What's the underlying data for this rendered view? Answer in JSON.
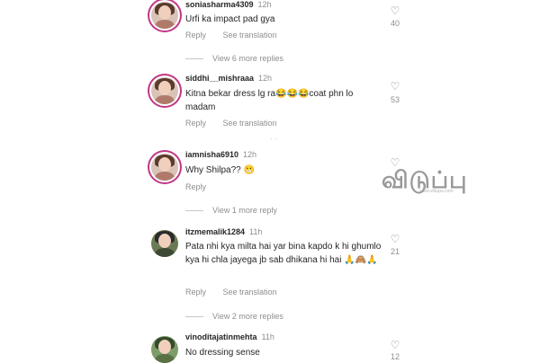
{
  "comments": [
    {
      "username": "soniasharma4309",
      "time": "12h",
      "text": "Urfi ka impact pad gya",
      "likes": "40",
      "actions": {
        "reply": "Reply",
        "translate": "See translation"
      },
      "replies_link": "View 6 more replies"
    },
    {
      "username": "siddhi__mishraaa",
      "time": "12h",
      "text": "Kitna bekar dress lg ra😂😂😂coat phn lo madam",
      "likes": "53",
      "actions": {
        "reply": "Reply",
        "translate": "See translation"
      }
    },
    {
      "username": "iamnisha6910",
      "time": "12h",
      "text": "Why Shilpa?? 😬",
      "likes": "",
      "actions": {
        "reply": "Reply"
      },
      "replies_link": "View 1 more reply"
    },
    {
      "username": "itzmemalik1284",
      "time": "11h",
      "text": "Pata nhi kya milta hai yar bina kapdo k hi ghumlo kya hi chla jayega jb sab dhikana hi hai 🙏🙈🙏",
      "likes": "21",
      "actions": {
        "reply": "Reply",
        "translate": "See translation"
      },
      "replies_link": "View 2 more replies"
    },
    {
      "username": "vinoditajatinmehta",
      "time": "11h",
      "text": "No dressing sense",
      "likes": "12"
    }
  ],
  "watermark": {
    "main": "விடுப்பு",
    "sub": "www.vidupu.com"
  },
  "icons": {
    "like": "heart-icon"
  }
}
